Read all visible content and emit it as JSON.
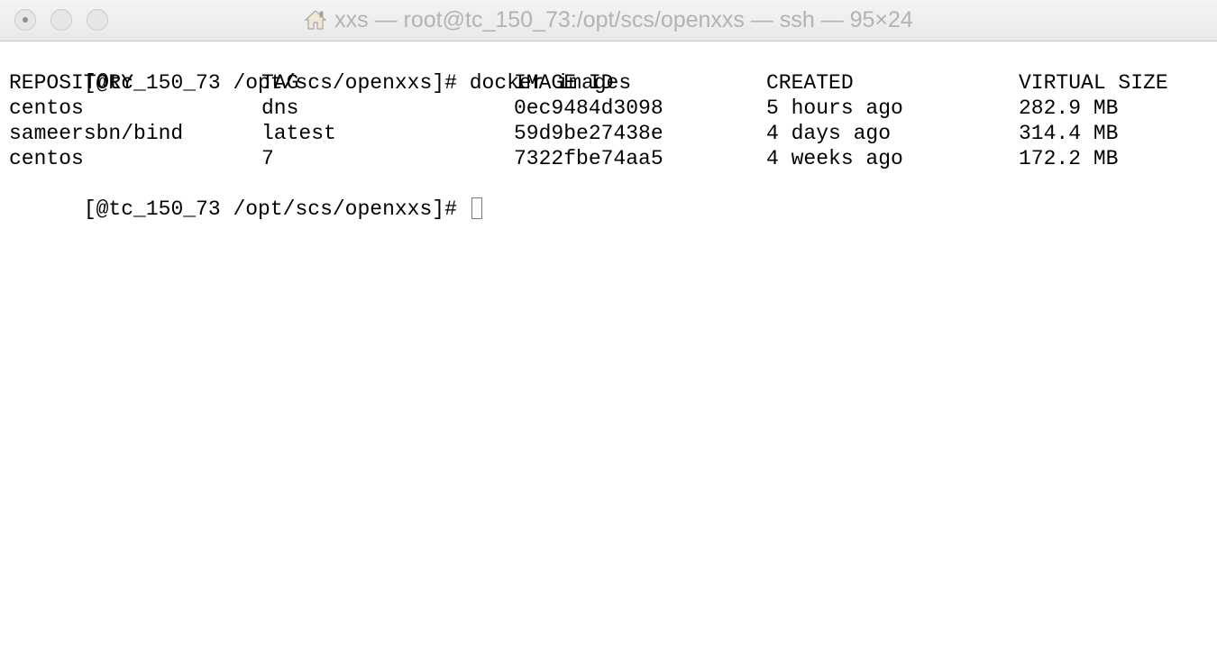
{
  "window": {
    "title": "xxs — root@tc_150_73:/opt/scs/openxxs — ssh — 95×24",
    "title_icon": "home-icon"
  },
  "terminal": {
    "prompt": "[@tc_150_73 /opt/scs/openxxs]#",
    "command": "docker images",
    "headers": {
      "repository": "REPOSITORY",
      "tag": "TAG",
      "image_id": "IMAGE ID",
      "created": "CREATED",
      "virtual_size": "VIRTUAL SIZE"
    },
    "rows": [
      {
        "repository": "centos",
        "tag": "dns",
        "image_id": "0ec9484d3098",
        "created": "5 hours ago",
        "virtual_size": "282.9 MB"
      },
      {
        "repository": "sameersbn/bind",
        "tag": "latest",
        "image_id": "59d9be27438e",
        "created": "4 days ago",
        "virtual_size": "314.4 MB"
      },
      {
        "repository": "centos",
        "tag": "7",
        "image_id": "7322fbe74aa5",
        "created": "4 weeks ago",
        "virtual_size": "172.2 MB"
      }
    ],
    "final_prompt": "[@tc_150_73 /opt/scs/openxxs]#"
  },
  "colors": {
    "title_text": "#b3b3b3",
    "terminal_text": "#000000",
    "background": "#ffffff"
  }
}
